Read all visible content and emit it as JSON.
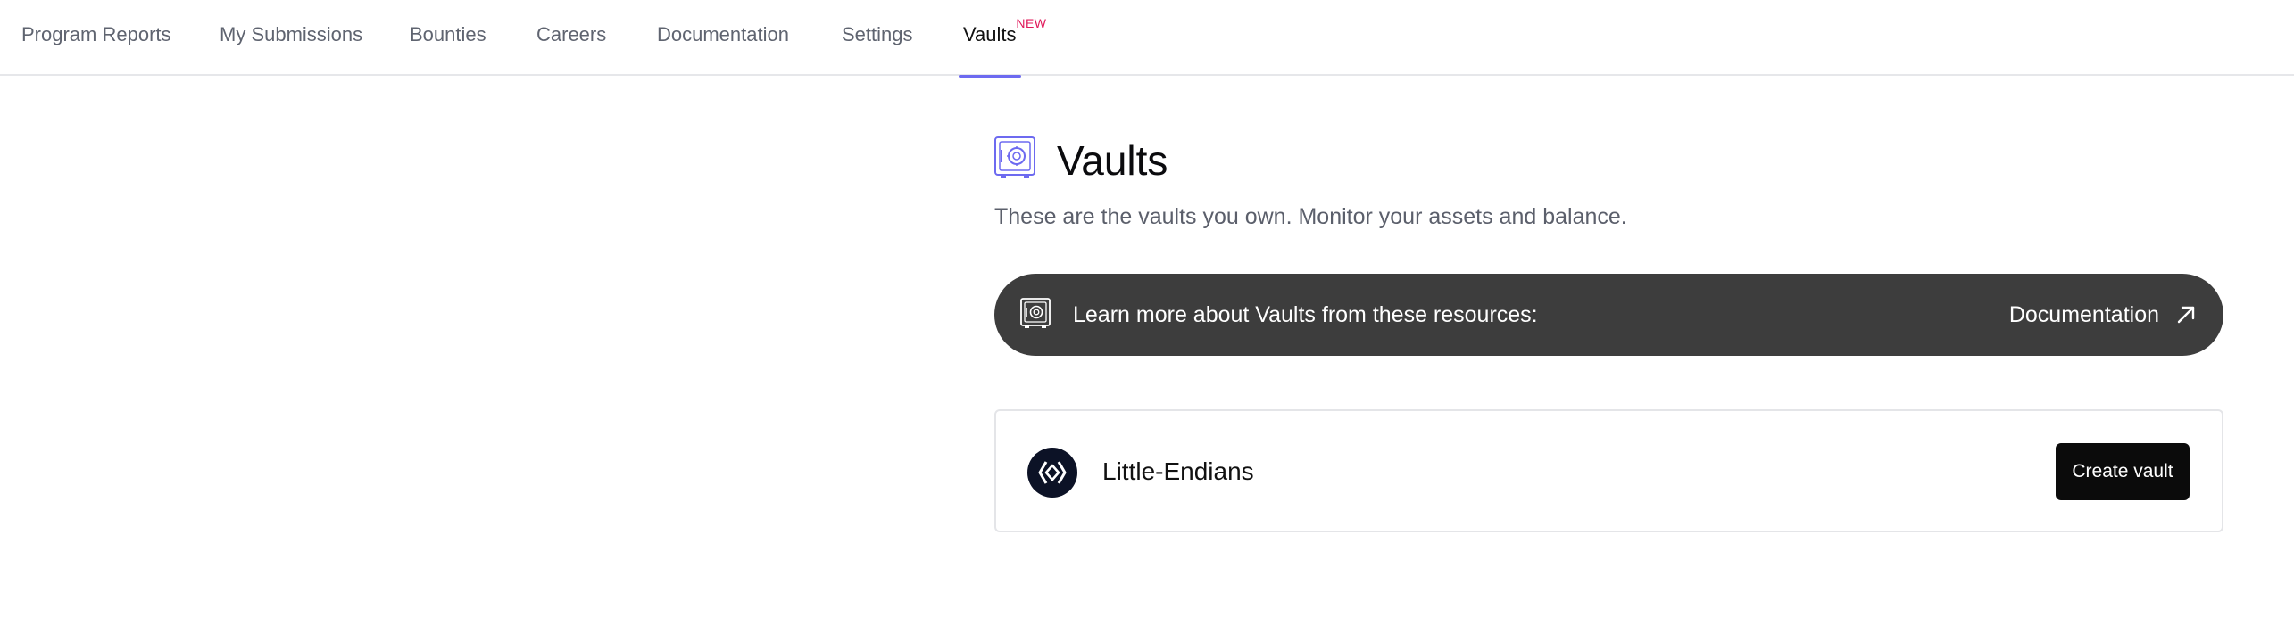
{
  "nav": {
    "tabs": [
      {
        "label": "Program Reports",
        "active": false
      },
      {
        "label": "My Submissions",
        "active": false
      },
      {
        "label": "Bounties",
        "active": false
      },
      {
        "label": "Careers",
        "active": false
      },
      {
        "label": "Documentation",
        "active": false
      },
      {
        "label": "Settings",
        "active": false
      },
      {
        "label": "Vaults",
        "active": true,
        "badge": "NEW"
      }
    ]
  },
  "page": {
    "icon": "vault-safe-icon",
    "title": "Vaults",
    "subtitle": "These are the vaults you own. Monitor your assets and balance."
  },
  "banner": {
    "icon": "vault-safe-icon",
    "text": "Learn more about Vaults from these resources:",
    "link_label": "Documentation",
    "link_icon": "arrow-up-right-icon"
  },
  "vault_card": {
    "avatar_icon": "little-endians-logo-icon",
    "org_name": "Little-Endians",
    "create_button_label": "Create vault"
  },
  "colors": {
    "accent": "#6d6af0",
    "badge": "#e0195a",
    "banner_bg": "#3d3d3d",
    "button_bg": "#0b0b0b",
    "avatar_bg": "#0c1226"
  }
}
